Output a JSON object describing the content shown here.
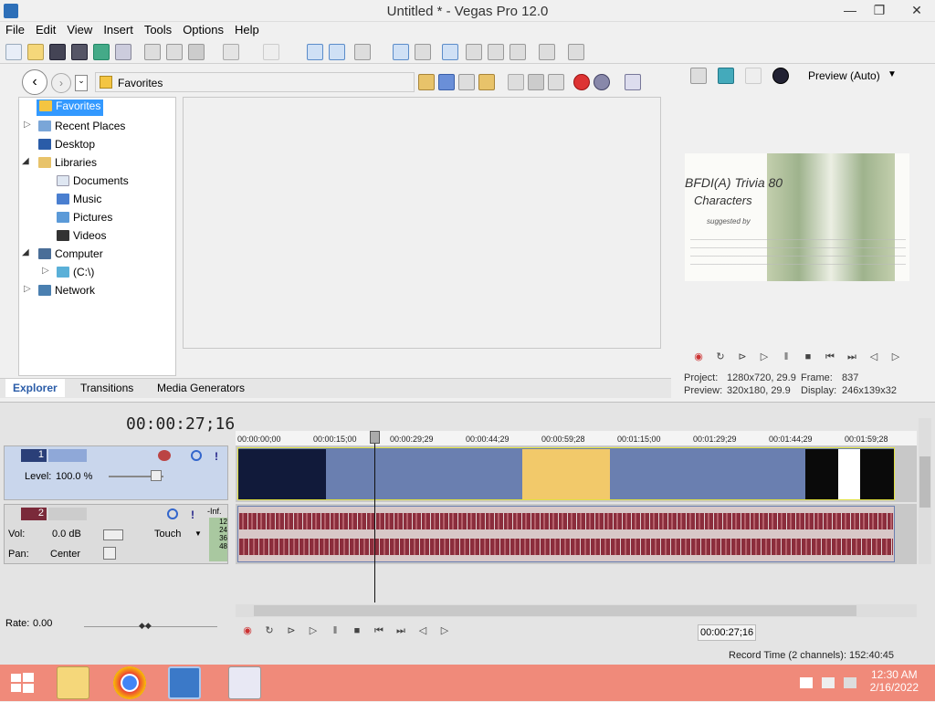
{
  "window": {
    "title": "Untitled * - Vegas Pro 12.0",
    "min": "—",
    "max": "❐",
    "close": "✕"
  },
  "menu": [
    "File",
    "Edit",
    "View",
    "Insert",
    "Tools",
    "Options",
    "Help"
  ],
  "explorer": {
    "path": "Favorites",
    "tree": [
      {
        "label": "Favorites",
        "selected": true
      },
      {
        "label": "Recent Places"
      },
      {
        "label": "Desktop"
      },
      {
        "label": "Libraries"
      },
      {
        "label": "Documents"
      },
      {
        "label": "Music"
      },
      {
        "label": "Pictures"
      },
      {
        "label": "Videos"
      },
      {
        "label": "Computer"
      },
      {
        "label": "(C:\\)"
      },
      {
        "label": "Network"
      }
    ],
    "tabs": [
      "Explorer",
      "Transitions",
      "Media Generators"
    ]
  },
  "preview": {
    "mode": "Preview (Auto)",
    "project_label": "Project:",
    "project_value": "1280x720, 29.9",
    "frame_label": "Frame:",
    "frame_value": "837",
    "preview_label": "Preview:",
    "preview_value": "320x180, 29.9",
    "display_label": "Display:",
    "display_value": "246x139x32",
    "video_text_1": "BFDI(A) Trivia 80",
    "video_text_2": "Characters",
    "video_text_3": "suggested by"
  },
  "timeline": {
    "timecode": "00:00:27;16",
    "ruler": [
      "00:00:00;00",
      "00:00:15;00",
      "00:00:29;29",
      "00:00:44;29",
      "00:00:59;28",
      "00:01:15;00",
      "00:01:29;29",
      "00:01:44;29",
      "00:01:59;28"
    ],
    "track1": {
      "num": "1",
      "level_label": "Level:",
      "level_value": "100.0 %"
    },
    "track2": {
      "num": "2",
      "vol_label": "Vol:",
      "vol_value": "0.0 dB",
      "pan_label": "Pan:",
      "pan_value": "Center",
      "touch": "Touch",
      "inf": "-Inf.",
      "meter": [
        "12",
        "24",
        "36",
        "48"
      ]
    },
    "rate_label": "Rate:",
    "rate_value": "0.00",
    "cursor_time": "00:00:27;16",
    "record_time": "Record Time (2 channels): 152:40:45"
  },
  "taskbar": {
    "time": "12:30 AM",
    "date": "2/16/2022"
  },
  "colors": {
    "video_track": "#6a7fb0",
    "audio_wave": "#8b2d3c",
    "taskbar": "#f08a7a",
    "selected": "#3399ff"
  }
}
